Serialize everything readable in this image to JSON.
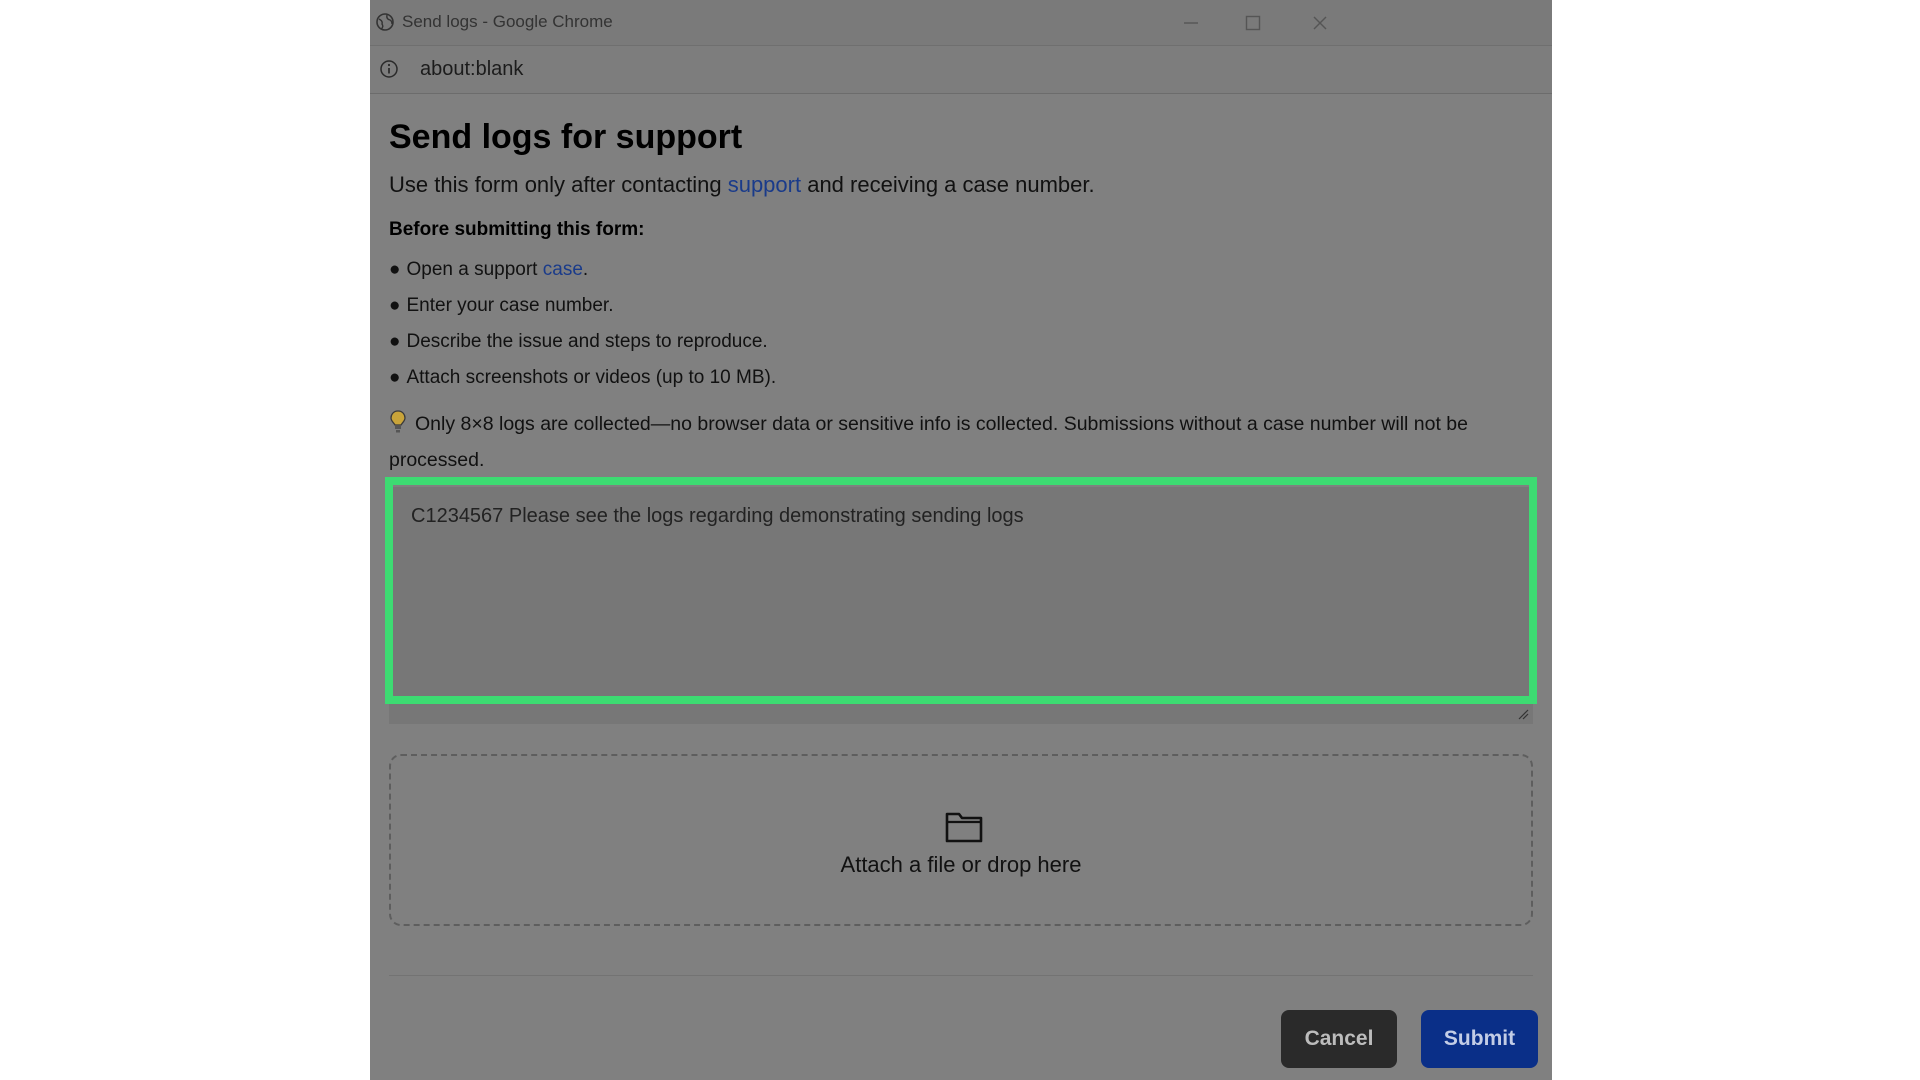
{
  "window": {
    "title": "Send logs - Google Chrome",
    "url": "about:blank"
  },
  "page": {
    "heading": "Send logs for support",
    "intro_before": "Use this form only after contacting ",
    "intro_link": "support",
    "intro_after": " and receiving a case number.",
    "before_title": "Before submitting this form:",
    "bullets": {
      "b1_text": "Open a support ",
      "b1_link": "case",
      "b1_end": ".",
      "b2": "Enter your case number.",
      "b3": "Describe the issue and steps to reproduce.",
      "b4": "Attach screenshots or videos (up to 10 MB)."
    },
    "note": "Only 8×8 logs are collected—no browser data or sensitive info is collected. Submissions without a case number will not be processed."
  },
  "form": {
    "description_value": "C1234567 Please see the logs regarding demonstrating sending logs",
    "attach_label": "Attach a file or drop here",
    "cancel_label": "Cancel",
    "submit_label": "Submit"
  },
  "colors": {
    "highlight": "#3ddb72",
    "link": "#1a3b8a",
    "submit_bg": "#0a2f88",
    "cancel_bg": "#2a2a2a"
  },
  "icons": [
    "globe-icon",
    "minimize-icon",
    "maximize-icon",
    "close-icon",
    "info-icon",
    "lightbulb-icon",
    "folder-icon",
    "resize-handle-icon"
  ]
}
